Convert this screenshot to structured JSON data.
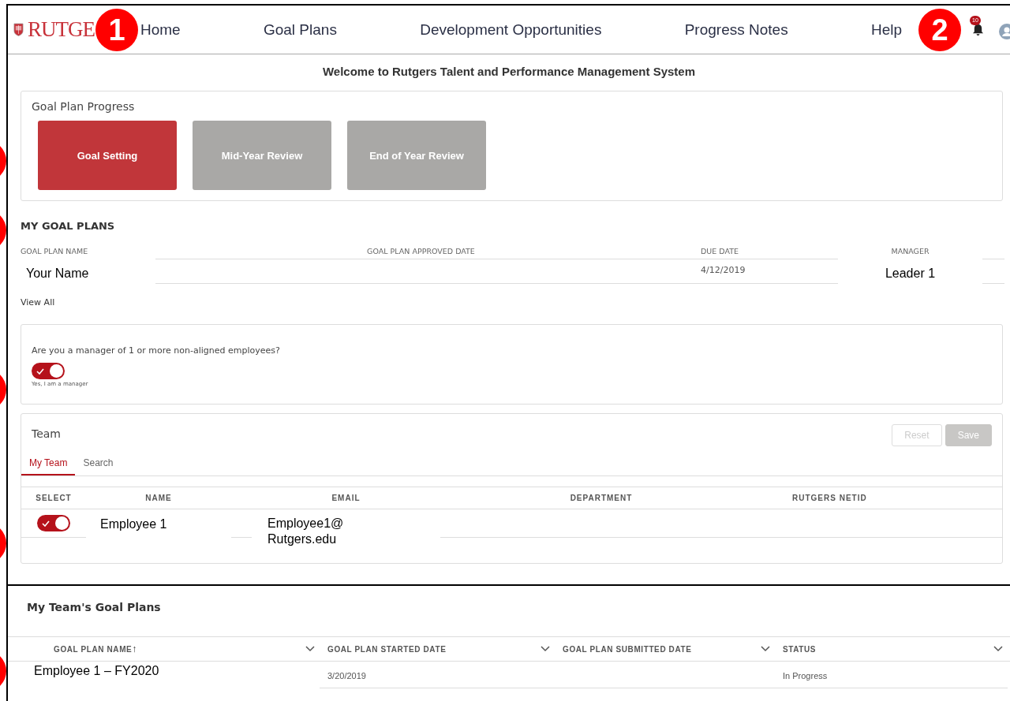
{
  "header": {
    "logo_text": "RUTGE",
    "nav": [
      {
        "label": "Home"
      },
      {
        "label": "Goal Plans"
      },
      {
        "label": "Development Opportunities"
      },
      {
        "label": "Progress Notes"
      },
      {
        "label": "Help"
      }
    ],
    "notification_count": "10"
  },
  "callouts": [
    {
      "number": "1"
    },
    {
      "number": "2"
    }
  ],
  "welcome": "Welcome to Rutgers Talent and Performance Management System",
  "progress": {
    "title": "Goal Plan Progress",
    "stages": [
      {
        "label": "Goal Setting",
        "selected": true
      },
      {
        "label": "Mid-Year Review",
        "selected": false
      },
      {
        "label": "End of Year Review",
        "selected": false
      }
    ]
  },
  "my_goal_plans": {
    "title": "MY GOAL PLANS",
    "columns": [
      "GOAL PLAN NAME",
      "GOAL PLAN APPROVED DATE",
      "DUE DATE",
      "MANAGER"
    ],
    "rows": [
      {
        "name": "Your Name",
        "due_date": "4/12/2019",
        "manager": "Leader 1"
      }
    ],
    "view_all": "View All"
  },
  "manager_question": {
    "question": "Are you a manager of 1 or more non-aligned employees?",
    "on": true,
    "caption": "Yes, I am a manager"
  },
  "team": {
    "title": "Team",
    "buttons": [
      {
        "label": "Reset",
        "kind": "outline",
        "disabled": true
      },
      {
        "label": "Save",
        "kind": "filled",
        "disabled": true
      }
    ],
    "tabs": [
      {
        "label": "My Team",
        "selected": true
      },
      {
        "label": "Search",
        "selected": false
      }
    ],
    "columns": [
      "SELECT",
      "NAME",
      "EMAIL",
      "DEPARTMENT",
      "RUTGERS NETID"
    ],
    "rows": [
      {
        "selected": true,
        "name": "Employee 1",
        "email": "Employee1@\nRutgers.edu"
      }
    ]
  },
  "team_goal_plans": {
    "title": "My Team's Goal Plans",
    "columns": [
      {
        "label": "GOAL PLAN NAME",
        "sort_arrow": "↑"
      },
      {
        "label": "GOAL PLAN STARTED DATE"
      },
      {
        "label": "GOAL PLAN SUBMITTED DATE"
      },
      {
        "label": "STATUS"
      }
    ],
    "rows": [
      {
        "name": "Employee 1 – FY2020",
        "started": "3/20/2019",
        "status": "In Progress"
      }
    ]
  }
}
